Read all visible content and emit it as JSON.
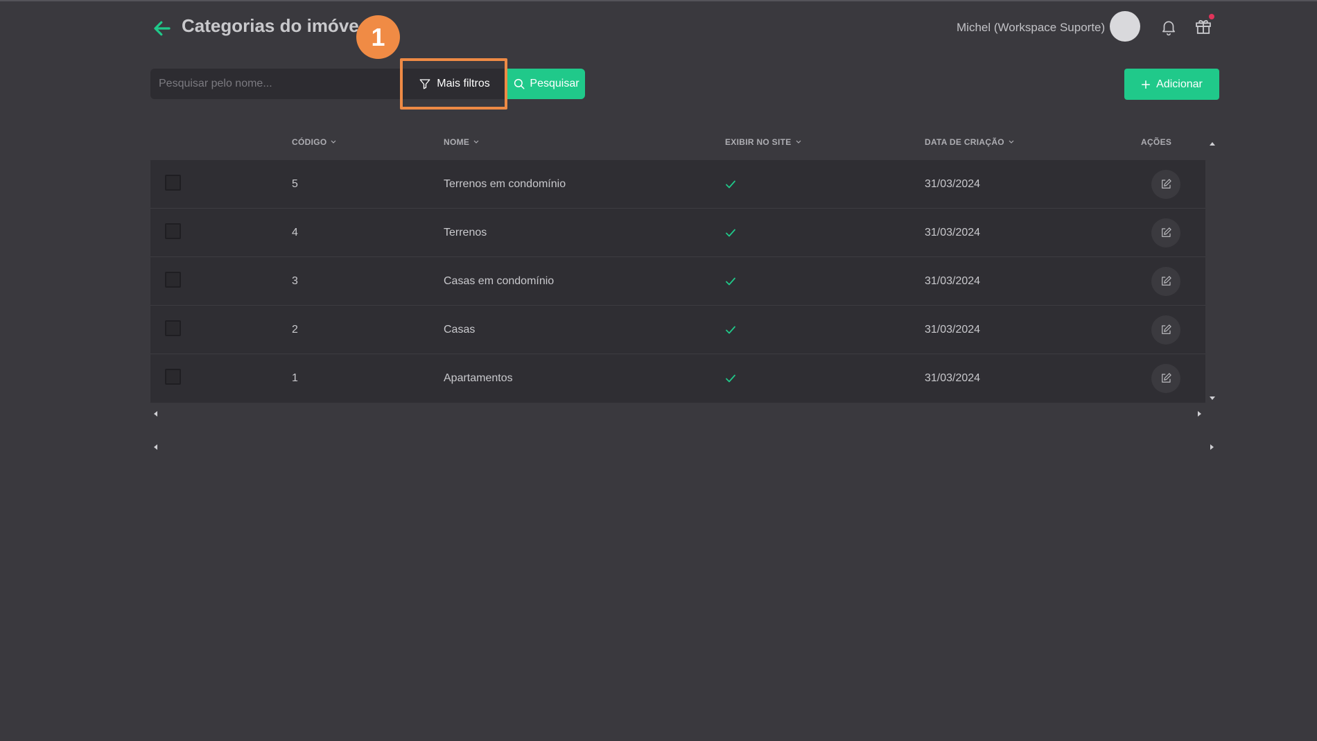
{
  "header": {
    "title": "Categorias do imóve",
    "user_name": "Michel (Workspace Suporte)"
  },
  "toolbar": {
    "search_placeholder": "Pesquisar pelo nome...",
    "more_filters_label": "Mais filtros",
    "search_label": "Pesquisar",
    "add_label": "Adicionar"
  },
  "annotation": {
    "step_number": "1"
  },
  "table": {
    "columns": {
      "code": "CÓDIGO",
      "name": "NOME",
      "show_on_site": "EXIBIR NO SITE",
      "created_at": "DATA DE CRIAÇÃO",
      "actions": "AÇÕES"
    },
    "rows": [
      {
        "code": "5",
        "name": "Terrenos em condomínio",
        "show_on_site": true,
        "created_at": "31/03/2024"
      },
      {
        "code": "4",
        "name": "Terrenos",
        "show_on_site": true,
        "created_at": "31/03/2024"
      },
      {
        "code": "3",
        "name": "Casas em condomínio",
        "show_on_site": true,
        "created_at": "31/03/2024"
      },
      {
        "code": "2",
        "name": "Casas",
        "show_on_site": true,
        "created_at": "31/03/2024"
      },
      {
        "code": "1",
        "name": "Apartamentos",
        "show_on_site": true,
        "created_at": "31/03/2024"
      }
    ]
  },
  "colors": {
    "accent": "#20c98a",
    "background": "#3a393e",
    "row_background": "#2f2e33",
    "highlight": "#ee8a45"
  },
  "icons": {
    "back": "arrow-left-icon",
    "notifications": "bell-icon",
    "gifts": "gift-icon",
    "filter": "funnel-icon",
    "search": "magnifier-icon",
    "add": "plus-icon",
    "check": "check-icon",
    "edit": "edit-icon"
  }
}
